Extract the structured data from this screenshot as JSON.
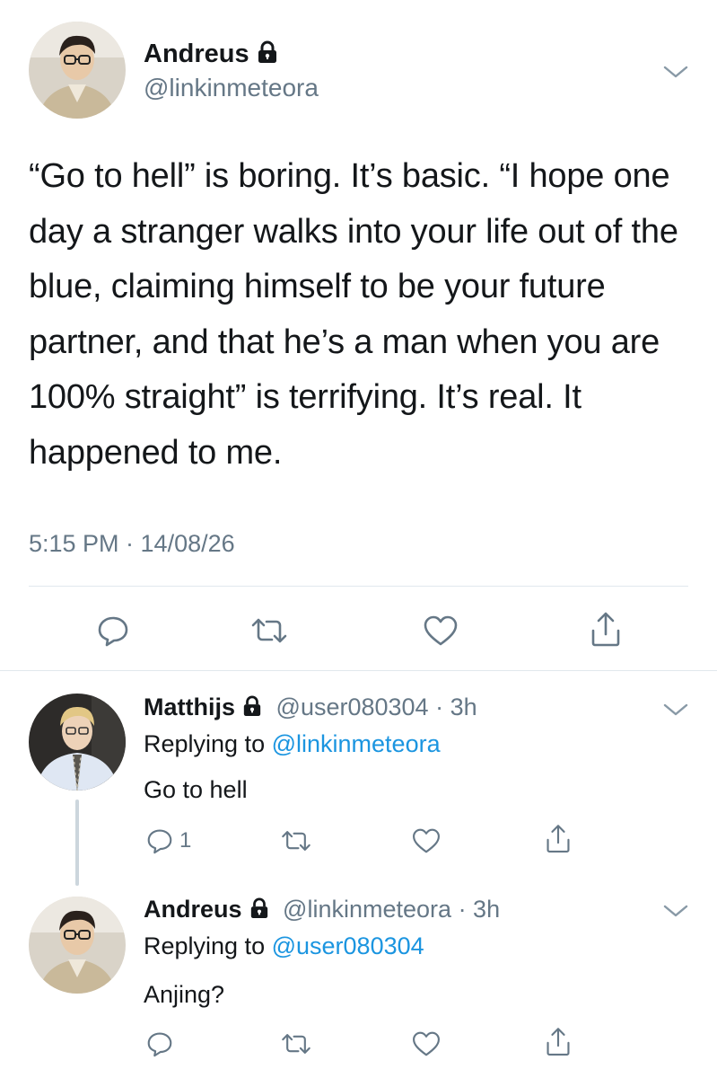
{
  "tweet": {
    "author_name": "Andreus",
    "author_handle": "@linkinmeteora",
    "text": "“Go to hell” is boring. It’s basic. “I hope one day a stranger walks into your life out of the blue, claiming himself to be your future partner, and that he’s a man when you are 100% straight” is terrifying. It’s real. It happened to me.",
    "timestamp": "5:15 PM · 14/08/26",
    "actions": [
      "reply-icon",
      "retweet-icon",
      "like-icon",
      "share-icon"
    ]
  },
  "replies": [
    {
      "author_name": "Matthijs",
      "author_handle": "@user080304",
      "time": "· 3h",
      "replying_prefix": "Replying to",
      "replying_to": "@linkinmeteora",
      "text": "Go to hell",
      "reply_count": "1"
    },
    {
      "author_name": "Andreus",
      "author_handle": "@linkinmeteora",
      "time": "· 3h",
      "replying_prefix": "Replying to",
      "replying_to": "@user080304",
      "text": "Anjing?",
      "reply_count": ""
    }
  ],
  "colors": {
    "text": "#14171a",
    "muted": "#657786",
    "link": "#1b95e0",
    "divider": "#e1e8ed"
  }
}
